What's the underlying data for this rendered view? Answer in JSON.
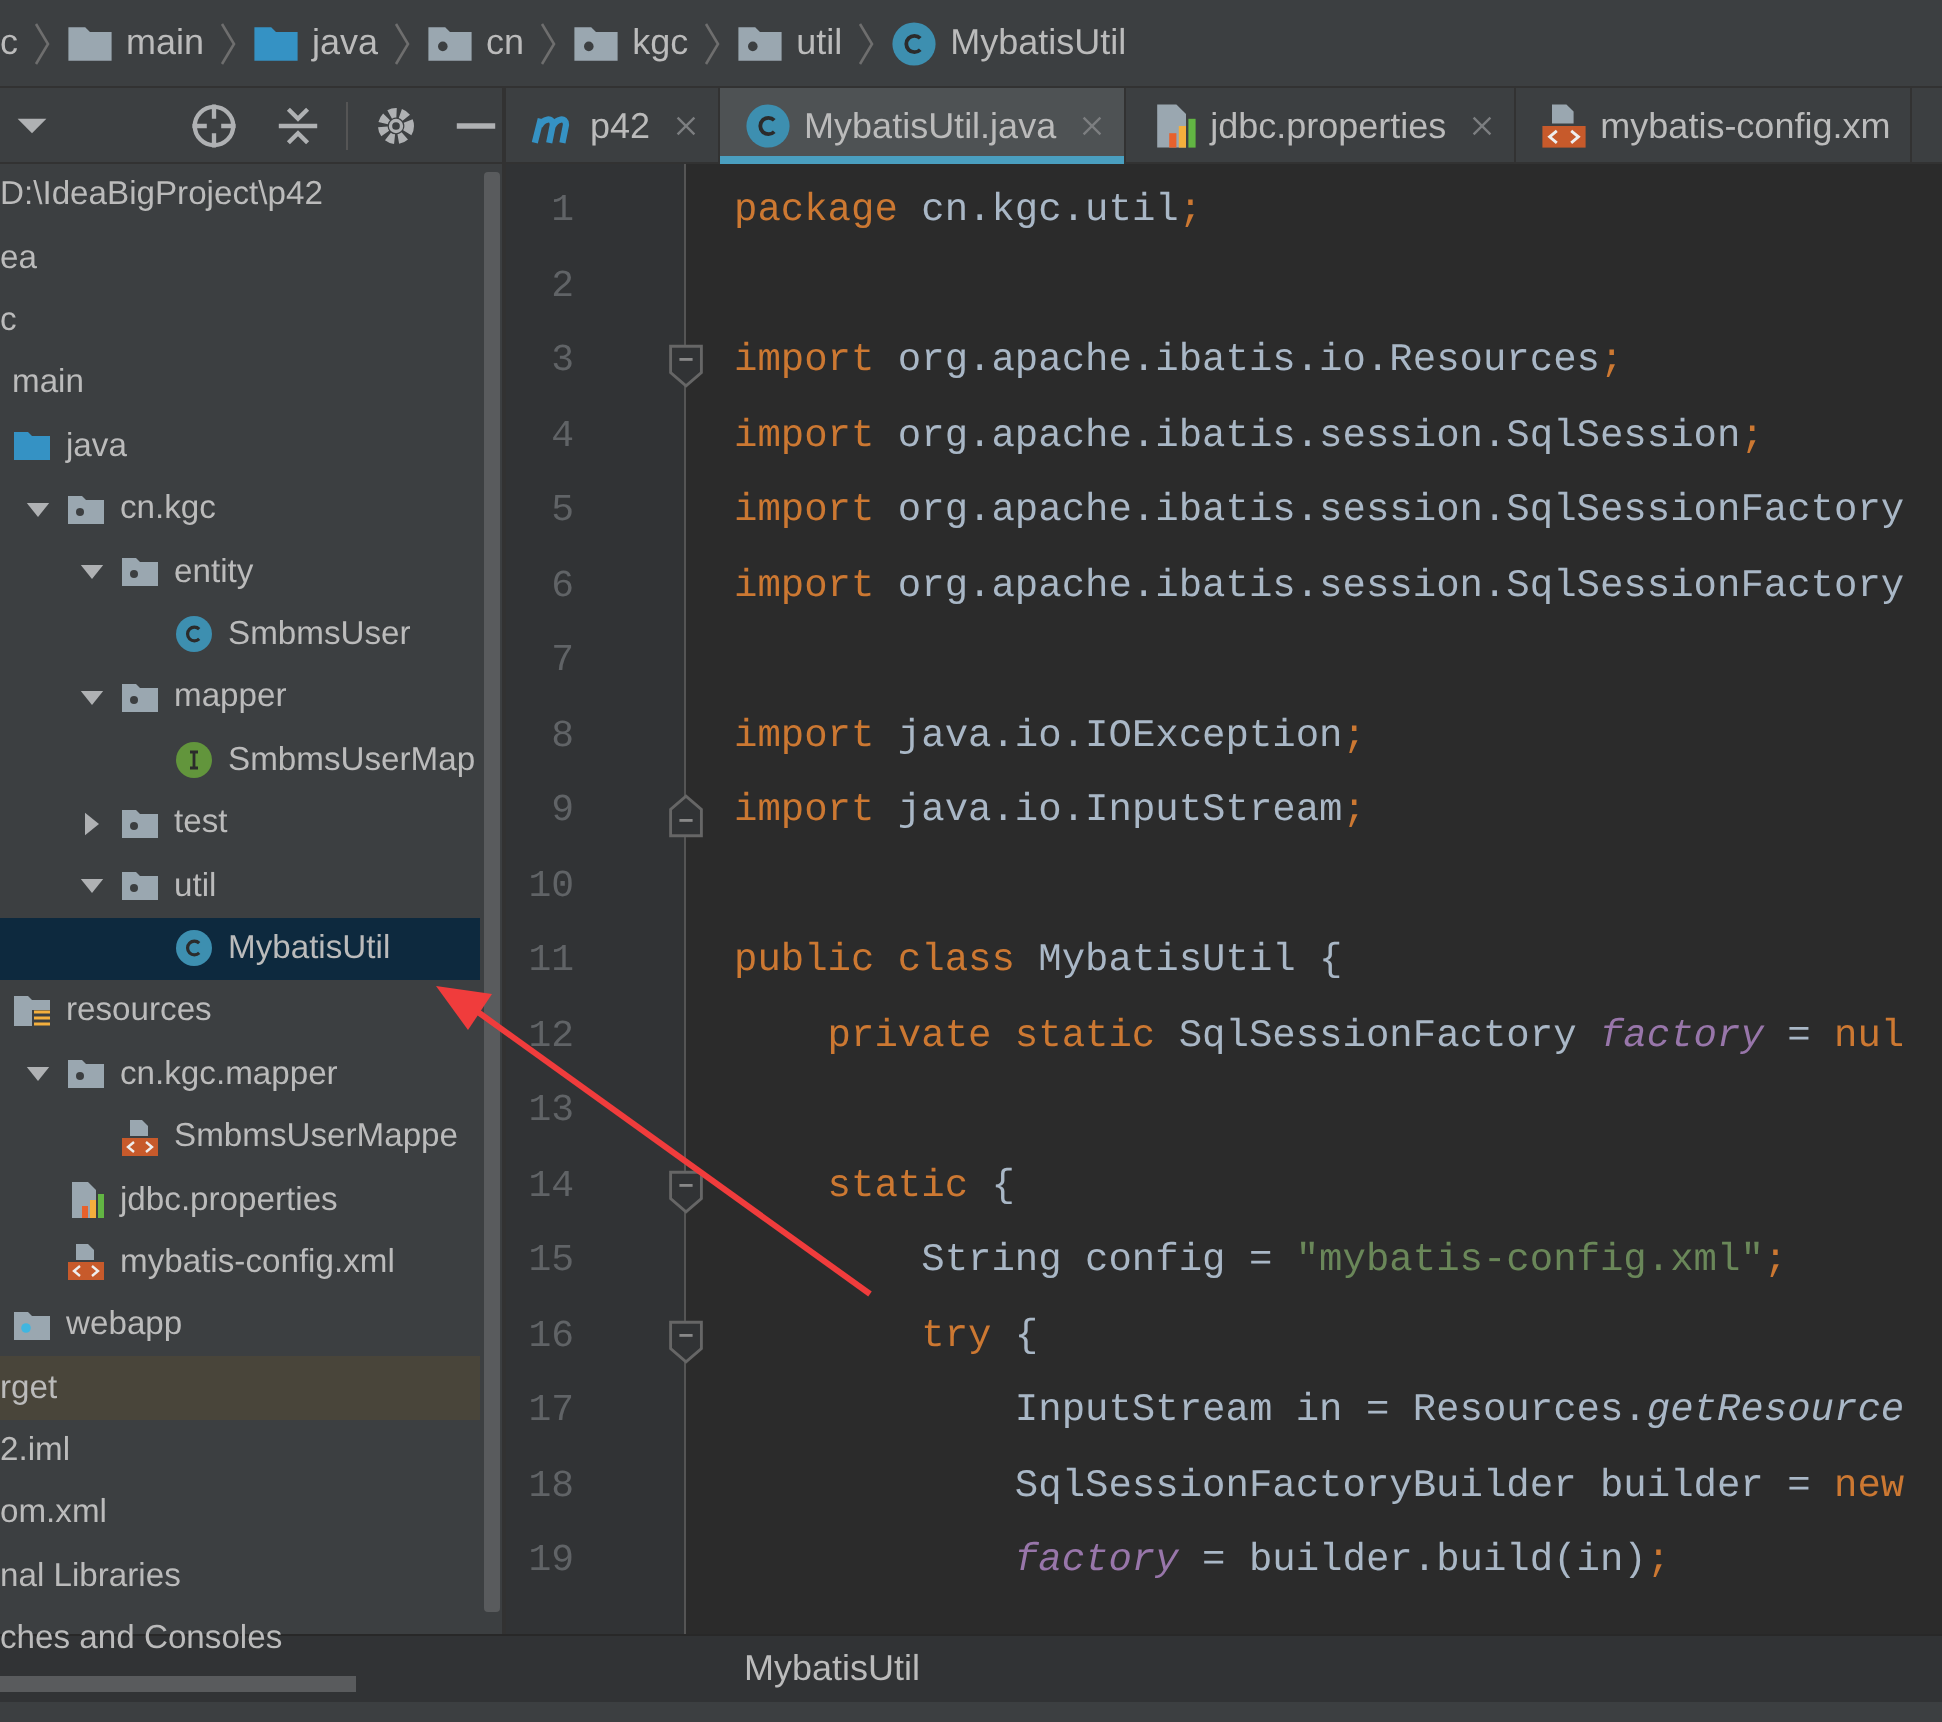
{
  "breadcrumb": [
    {
      "label": "c"
    },
    {
      "label": "main",
      "kind": "folder"
    },
    {
      "label": "java",
      "kind": "source-folder"
    },
    {
      "label": "cn",
      "kind": "package"
    },
    {
      "label": "kgc",
      "kind": "package"
    },
    {
      "label": "util",
      "kind": "package"
    },
    {
      "label": "MybatisUtil",
      "kind": "class"
    }
  ],
  "tabs": [
    {
      "label": "p42",
      "kind": "maven",
      "selected": false,
      "closable": true
    },
    {
      "label": "MybatisUtil.java",
      "kind": "class",
      "selected": true,
      "closable": true
    },
    {
      "label": "jdbc.properties",
      "kind": "properties",
      "selected": false,
      "closable": true
    },
    {
      "label": "mybatis-config.xm",
      "kind": "xml",
      "selected": false,
      "closable": false
    }
  ],
  "tree": [
    {
      "label": "D:\\IdeaBigProject\\p42",
      "selected": false,
      "excluded": false,
      "children": [
        {
          "label": "ea",
          "selected": false,
          "excluded": false
        },
        {
          "label": "c",
          "selected": false,
          "excluded": false,
          "children": [
            {
              "label": "main",
              "selected": false,
              "excluded": false,
              "children": [
                {
                  "label": "java",
                  "kind": "source-folder",
                  "selected": false,
                  "excluded": false,
                  "children": [
                    {
                      "label": "cn.kgc",
                      "kind": "package",
                      "expanded": true,
                      "selected": false,
                      "excluded": false,
                      "children": [
                        {
                          "label": "entity",
                          "kind": "package",
                          "expanded": true,
                          "selected": false,
                          "excluded": false,
                          "children": [
                            {
                              "label": "SmbmsUser",
                              "kind": "class",
                              "selected": false,
                              "excluded": false
                            }
                          ]
                        },
                        {
                          "label": "mapper",
                          "kind": "package",
                          "expanded": true,
                          "selected": false,
                          "excluded": false,
                          "children": [
                            {
                              "label": "SmbmsUserMap",
                              "kind": "interface",
                              "selected": false,
                              "excluded": false
                            }
                          ]
                        },
                        {
                          "label": "test",
                          "kind": "package",
                          "expanded": false,
                          "selected": false,
                          "excluded": false
                        },
                        {
                          "label": "util",
                          "kind": "package",
                          "expanded": true,
                          "selected": false,
                          "excluded": false,
                          "children": [
                            {
                              "label": "MybatisUtil",
                              "kind": "class",
                              "selected": true,
                              "excluded": false
                            }
                          ]
                        }
                      ]
                    }
                  ]
                },
                {
                  "label": "resources",
                  "kind": "resources",
                  "selected": false,
                  "excluded": false,
                  "children": [
                    {
                      "label": "cn.kgc.mapper",
                      "kind": "package",
                      "expanded": true,
                      "selected": false,
                      "excluded": false,
                      "children": [
                        {
                          "label": "SmbmsUserMappe",
                          "kind": "xml",
                          "selected": false,
                          "excluded": false
                        }
                      ]
                    },
                    {
                      "label": "jdbc.properties",
                      "kind": "properties",
                      "selected": false,
                      "excluded": false
                    },
                    {
                      "label": "mybatis-config.xml",
                      "kind": "xml",
                      "selected": false,
                      "excluded": false
                    }
                  ]
                },
                {
                  "label": "webapp",
                  "kind": "web-folder",
                  "selected": false,
                  "excluded": false
                }
              ]
            }
          ]
        },
        {
          "label": "rget",
          "selected": false,
          "excluded": true
        },
        {
          "label": "2.iml",
          "selected": false,
          "excluded": false
        },
        {
          "label": "om.xml",
          "selected": false,
          "excluded": false
        }
      ]
    },
    {
      "label": "nal Libraries",
      "selected": false,
      "excluded": false
    },
    {
      "label": "ches and Consoles",
      "selected": false,
      "excluded": false
    }
  ],
  "code": [
    {
      "number": "1",
      "kind": "plain",
      "tokens": [
        {
          "kind": "keyword",
          "text": "package"
        },
        {
          "kind": "plain",
          "text": " cn.kgc.util"
        },
        {
          "kind": "keyword",
          "text": ";"
        }
      ]
    },
    {
      "number": "2",
      "kind": "plain"
    },
    {
      "number": "3",
      "kind": "fold-start",
      "tokens": [
        {
          "kind": "keyword",
          "text": "import"
        },
        {
          "kind": "plain",
          "text": " org.apache.ibatis.io.Resources"
        },
        {
          "kind": "keyword",
          "text": ";"
        }
      ]
    },
    {
      "number": "4",
      "kind": "plain",
      "tokens": [
        {
          "kind": "keyword",
          "text": "import"
        },
        {
          "kind": "plain",
          "text": " org.apache.ibatis.session.SqlSession"
        },
        {
          "kind": "keyword",
          "text": ";"
        }
      ]
    },
    {
      "number": "5",
      "kind": "plain",
      "tokens": [
        {
          "kind": "keyword",
          "text": "import"
        },
        {
          "kind": "plain",
          "text": " org.apache.ibatis.session.SqlSessionFactory"
        }
      ]
    },
    {
      "number": "6",
      "kind": "plain",
      "tokens": [
        {
          "kind": "keyword",
          "text": "import"
        },
        {
          "kind": "plain",
          "text": " org.apache.ibatis.session.SqlSessionFactory"
        }
      ]
    },
    {
      "number": "7",
      "kind": "plain"
    },
    {
      "number": "8",
      "kind": "plain",
      "tokens": [
        {
          "kind": "keyword",
          "text": "import"
        },
        {
          "kind": "plain",
          "text": " java.io.IOException"
        },
        {
          "kind": "keyword",
          "text": ";"
        }
      ]
    },
    {
      "number": "9",
      "kind": "fold-end",
      "tokens": [
        {
          "kind": "keyword",
          "text": "import"
        },
        {
          "kind": "plain",
          "text": " java.io.InputStream"
        },
        {
          "kind": "keyword",
          "text": ";"
        }
      ]
    },
    {
      "number": "10",
      "kind": "plain"
    },
    {
      "number": "11",
      "kind": "plain",
      "tokens": [
        {
          "kind": "keyword",
          "text": "public class"
        },
        {
          "kind": "plain",
          "text": " MybatisUtil {"
        }
      ]
    },
    {
      "number": "12",
      "kind": "plain",
      "tokens": [
        {
          "kind": "keyword",
          "text": "    private static"
        },
        {
          "kind": "plain",
          "text": " SqlSessionFactory "
        },
        {
          "kind": "field",
          "text": "factory"
        },
        {
          "kind": "plain",
          "text": " = "
        },
        {
          "kind": "keyword",
          "text": "nul"
        }
      ]
    },
    {
      "number": "13",
      "kind": "plain"
    },
    {
      "number": "14",
      "kind": "fold-start",
      "tokens": [
        {
          "kind": "keyword",
          "text": "    static"
        },
        {
          "kind": "plain",
          "text": " {"
        }
      ]
    },
    {
      "number": "15",
      "kind": "plain",
      "tokens": [
        {
          "kind": "plain",
          "text": "        String config = "
        },
        {
          "kind": "string",
          "text": "\"mybatis-config.xml\""
        },
        {
          "kind": "keyword",
          "text": ";"
        }
      ]
    },
    {
      "number": "16",
      "kind": "fold-start",
      "tokens": [
        {
          "kind": "keyword",
          "text": "        try"
        },
        {
          "kind": "plain",
          "text": " {"
        }
      ]
    },
    {
      "number": "17",
      "kind": "plain",
      "tokens": [
        {
          "kind": "plain",
          "text": "            InputStream in = Resources."
        },
        {
          "kind": "static-call",
          "text": "getResource"
        }
      ]
    },
    {
      "number": "18",
      "kind": "plain",
      "tokens": [
        {
          "kind": "plain",
          "text": "            SqlSessionFactoryBuilder builder = "
        },
        {
          "kind": "keyword",
          "text": "new"
        }
      ]
    },
    {
      "number": "19",
      "kind": "plain",
      "tokens": [
        {
          "kind": "field",
          "text": "            factory"
        },
        {
          "kind": "plain",
          "text": " = builder.build(in)"
        },
        {
          "kind": "keyword",
          "text": ";"
        }
      ]
    }
  ],
  "status_breadcrumb": "MybatisUtil"
}
